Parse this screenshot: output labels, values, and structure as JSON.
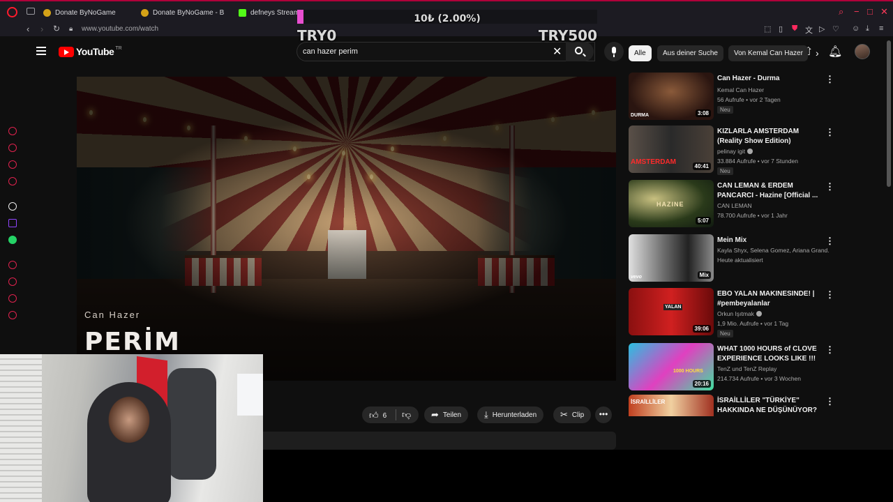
{
  "browser": {
    "tabs": [
      {
        "label": "Donate ByNoGame",
        "icon": "bynogame-favicon"
      },
      {
        "label": "Donate ByNoGame - BN",
        "icon": "bynogame-favicon"
      },
      {
        "label": "defneys Stream",
        "icon": "kick-favicon"
      }
    ],
    "url": "www.youtube.com/watch"
  },
  "donation": {
    "amount": "10₺ (2.00%)",
    "progress_percent": 2.0,
    "min_label": "TRY0",
    "max_label": "TRY500",
    "fill_color": "#e84fd0"
  },
  "youtube": {
    "logo_text": "YouTube",
    "logo_sup": "TR",
    "search_query": "can hazer perim",
    "player": {
      "artist": "Can Hazer",
      "title": "PERİM"
    },
    "actions": {
      "likes": "6",
      "share": "Teilen",
      "download": "Herunterladen",
      "clip": "Clip"
    },
    "chips": [
      "Alle",
      "Aus deiner Suche",
      "Von Kemal Can Hazer"
    ],
    "recommendations": [
      {
        "title": "Can Hazer - Durma",
        "channel": "Kemal Can Hazer",
        "meta": "56 Aufrufe • vor 2 Tagen",
        "badge": "Neu",
        "duration": "3:08",
        "brand": "DURMA",
        "verified": false
      },
      {
        "title": "KIZLARLA AMSTERDAM (Reality Show Edition)",
        "channel": "pelinay igit",
        "meta": "33.884 Aufrufe • vor 7 Stunden",
        "badge": "Neu",
        "duration": "40:41",
        "brand": "AMSTERDAM",
        "verified": true
      },
      {
        "title": "CAN LEMAN & ERDEM PANCARCI - Hazine [Official ...",
        "channel": "CAN LEMAN",
        "meta": "78.700 Aufrufe • vor 1 Jahr",
        "badge": "",
        "duration": "5:07",
        "brand": "HAZINE",
        "verified": false
      },
      {
        "title": "Mein Mix",
        "channel": "Kayla Shyx, Selena Gomez, Ariana Grand...",
        "meta": "Heute aktualisiert",
        "badge": "",
        "duration": "Mix",
        "brand": "vevo",
        "verified": false
      },
      {
        "title": "EBO YALAN MAKINESINDE! | #pembeyalanlar",
        "channel": "Orkun Işıtmak",
        "meta": "1,9 Mio. Aufrufe • vor 1 Tag",
        "badge": "Neu",
        "duration": "39:06",
        "brand": "YALAN",
        "verified": true
      },
      {
        "title": "WHAT 1000 HOURS of CLOVE EXPERIENCE LOOKS LIKE !!!",
        "channel": "TenZ  und TenZ Replay",
        "meta": "214.734 Aufrufe • vor 3 Wochen",
        "badge": "",
        "duration": "20:16",
        "brand": "1000 HOURS",
        "verified": false
      },
      {
        "title": "İSRAİLLİLER \"TÜRKİYE\" HAKKINDA NE DÜŞÜNÜYOR? |...",
        "channel": "",
        "meta": "",
        "badge": "",
        "duration": "",
        "brand": "İSRAİLLİLER",
        "verified": false
      }
    ]
  }
}
